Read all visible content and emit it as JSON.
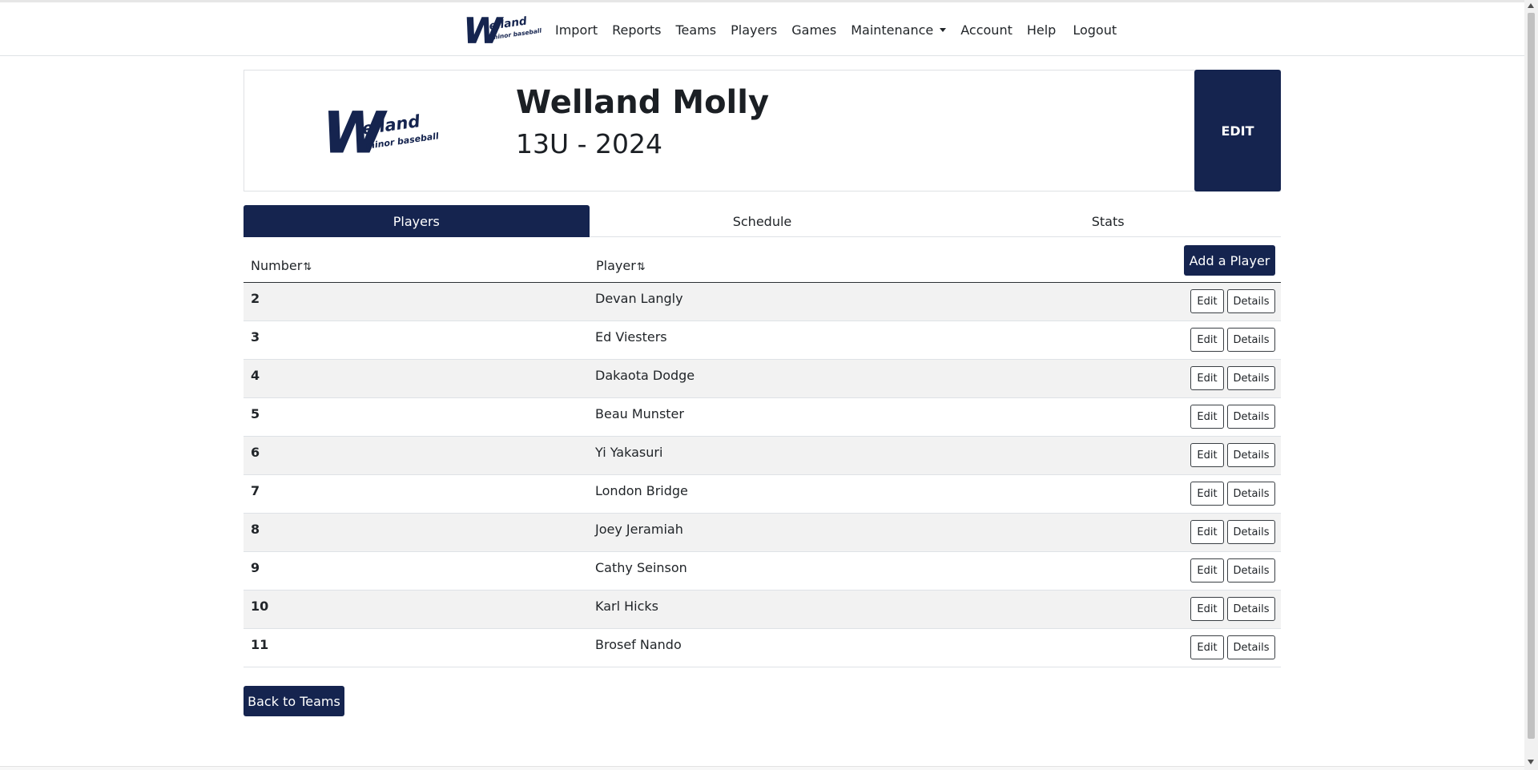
{
  "nav": {
    "items": [
      "Import",
      "Reports",
      "Teams",
      "Players",
      "Games",
      "Maintenance",
      "Account",
      "Help",
      "Logout"
    ]
  },
  "logo": {
    "letter": "W",
    "word": "elland",
    "sub": "minor baseball"
  },
  "team": {
    "name": "Welland Molly",
    "subtitle": "13U - 2024",
    "edit_label": "EDIT"
  },
  "tabs": [
    {
      "label": "Players",
      "active": true
    },
    {
      "label": "Schedule",
      "active": false
    },
    {
      "label": "Stats",
      "active": false
    }
  ],
  "table": {
    "headers": {
      "number": "Number",
      "player": "Player"
    },
    "sort_icon": "⇅",
    "add_label": "Add a Player",
    "edit_label": "Edit",
    "details_label": "Details",
    "rows": [
      {
        "number": "2",
        "player": "Devan Langly"
      },
      {
        "number": "3",
        "player": "Ed Viesters"
      },
      {
        "number": "4",
        "player": "Dakaota Dodge"
      },
      {
        "number": "5",
        "player": "Beau Munster"
      },
      {
        "number": "6",
        "player": "Yi Yakasuri"
      },
      {
        "number": "7",
        "player": "London Bridge"
      },
      {
        "number": "8",
        "player": "Joey Jeramiah"
      },
      {
        "number": "9",
        "player": "Cathy Seinson"
      },
      {
        "number": "10",
        "player": "Karl Hicks"
      },
      {
        "number": "11",
        "player": "Brosef Nando"
      }
    ]
  },
  "back_label": "Back to Teams",
  "colors": {
    "brand": "#15244f",
    "stripe": "#f2f2f2"
  }
}
